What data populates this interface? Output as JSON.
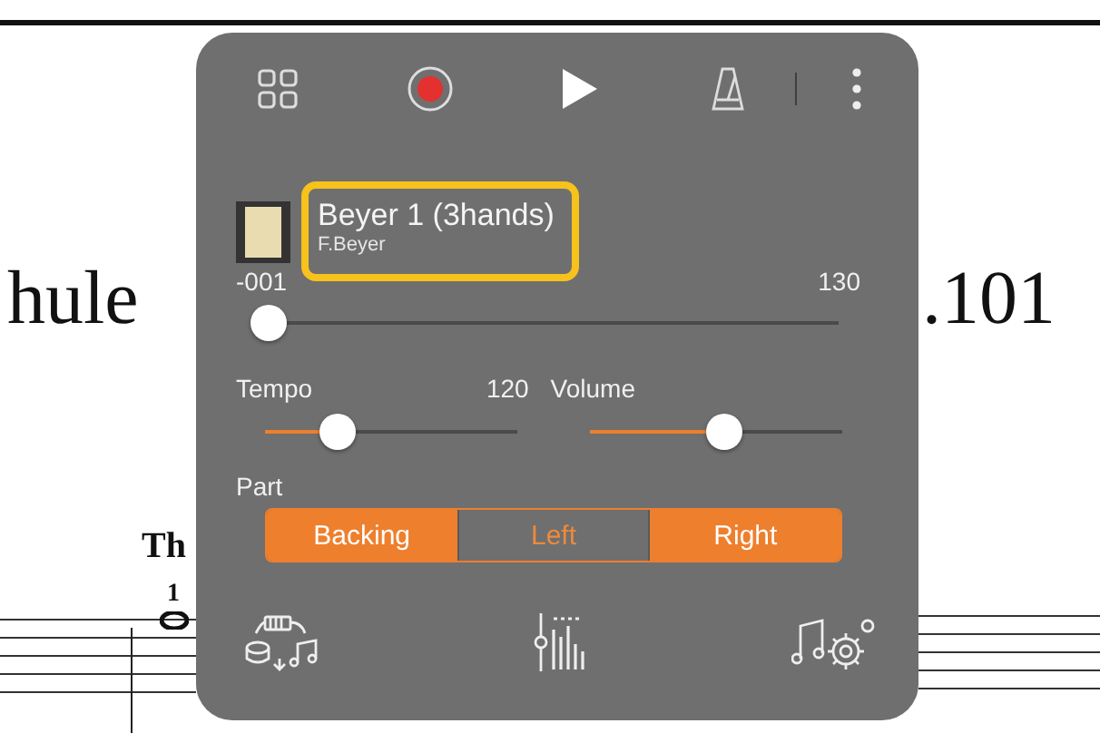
{
  "background": {
    "title_left": "hule",
    "title_right": ".101",
    "heading": "Th",
    "measure": "1"
  },
  "toolbar": {
    "record_on": true
  },
  "song": {
    "title": "Beyer 1 (3hands)",
    "composer": "F.Beyer",
    "highlighted": true
  },
  "position": {
    "start": "-001",
    "end": "130",
    "level": 0
  },
  "tempo": {
    "label": "Tempo",
    "value": "120",
    "level": 0.29
  },
  "volume": {
    "label": "Volume",
    "level": 0.53
  },
  "part": {
    "label": "Part",
    "parts": [
      {
        "label": "Backing",
        "on": true
      },
      {
        "label": "Left",
        "on": false
      },
      {
        "label": "Right",
        "on": true
      }
    ]
  }
}
